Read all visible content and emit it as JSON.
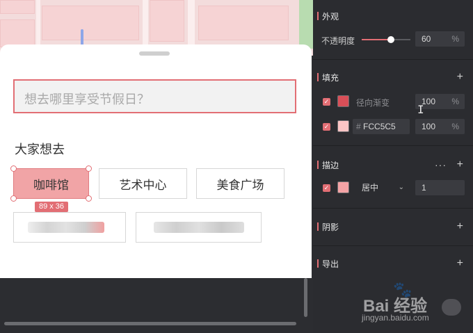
{
  "sheet": {
    "search_placeholder": "想去哪里享受节假日？",
    "section_title": "大家想去",
    "chips": [
      "咖啡馆",
      "艺术中心",
      "美食广场"
    ],
    "selection_size": "89 x 36"
  },
  "panel": {
    "appearance": {
      "title": "外观",
      "opacity_label": "不透明度",
      "opacity_value": "60",
      "opacity_unit": "%",
      "opacity_fraction": 0.6
    },
    "fill": {
      "title": "填充",
      "rows": [
        {
          "name": "径向渐变",
          "percent": "100",
          "unit": "%",
          "color": "#d94f58"
        },
        {
          "prefix": "#",
          "name": "FCC5C5",
          "percent": "100",
          "unit": "%",
          "color": "#fcc5c5"
        }
      ]
    },
    "stroke": {
      "title": "描边",
      "more": "···",
      "position": "居中",
      "width": "1",
      "color": "#f4a3a5"
    },
    "shadow": {
      "title": "阴影"
    },
    "export": {
      "title": "导出"
    },
    "plus": "+"
  },
  "watermark": {
    "brand": "Bai 经验",
    "url": "jingyan.baidu.com"
  },
  "colors": {
    "accent": "#e26e74",
    "panel_bg": "#2b2c30",
    "field_bg": "#3a3b40"
  }
}
